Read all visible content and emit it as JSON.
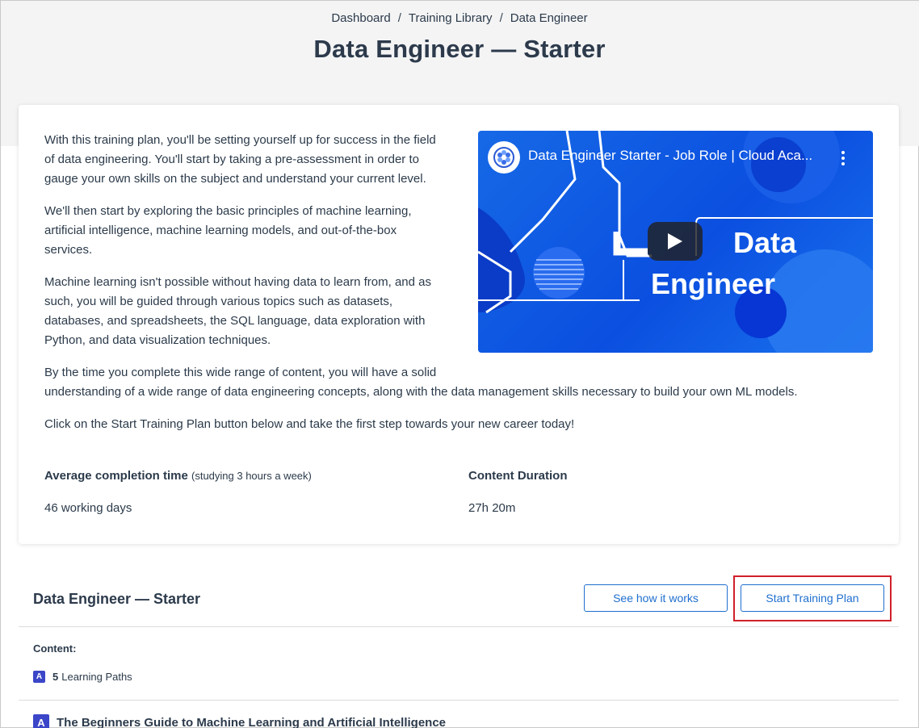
{
  "breadcrumb": {
    "items": [
      "Dashboard",
      "Training Library",
      "Data Engineer"
    ],
    "separator": "/"
  },
  "page_title": "Data Engineer — Starter",
  "description": {
    "paragraphs": [
      "With this training plan, you'll be setting yourself up for success in the field of data engineering. You'll start by taking a pre-assessment in order to gauge your own skills on the subject and understand your current level.",
      "We'll then start by exploring the basic principles of machine learning, artificial intelligence, machine learning models, and out-of-the-box services.",
      "Machine learning isn't possible without having data to learn from, and as such, you will be guided through various topics such as datasets, databases, and spreadsheets, the SQL language, data exploration with Python, and data visualization techniques.",
      "By the time you complete this wide range of content, you will have a solid understanding of a wide range of data engineering concepts, along with the data management skills necessary to build your own ML models.",
      "Click on the Start Training Plan button below and take the first step towards your new career today!"
    ],
    "lines": {
      "p1": [
        "With this training plan, you'll be setting yourself up for success in the field",
        "of data engineering. You'll start by taking a pre-assessment in order to",
        "gauge your own skills on the subject and understand your current level."
      ],
      "p2": [
        "We'll then start by exploring the basic principles of machine learning,",
        "artificial intelligence, machine learning models, and out-of-the-box",
        "services."
      ],
      "p3": [
        "Machine learning isn't possible without having data to learn from, and as",
        "such, you will be guided through various topics such as datasets,",
        "databases, and spreadsheets, the SQL language, data exploration with",
        "Python, and data visualization techniques."
      ],
      "p4": [
        "By the time you complete this wide range of content, you will have a solid",
        "understanding of a wide range of data engineering concepts, along with the data management skills necessary to build your own ML models."
      ],
      "p5": [
        "Click on the Start Training Plan button below and take the first step towards your new career today!"
      ]
    }
  },
  "video": {
    "title": "Data Engineer Starter - Job Role | Cloud Aca...",
    "overlay_line1": "Data",
    "overlay_line2": "Engineer",
    "logo_icon": "cloud-academy-logo-icon",
    "menu_icon": "more-vert-icon",
    "play_icon": "play-icon",
    "colors": {
      "background": "#0b4fe0",
      "accent": "#1a73ee"
    }
  },
  "stats": {
    "completion_label": "Average completion time",
    "completion_note": "(studying 3 hours a week)",
    "completion_value": "46 working days",
    "duration_label": "Content Duration",
    "duration_value": "27h 20m"
  },
  "plan": {
    "title": "Data Engineer — Starter",
    "see_how_label": "See how it works",
    "start_label": "Start Training Plan",
    "content_label": "Content:",
    "learning_paths_count": "5",
    "learning_paths_label": "Learning Paths",
    "first_path_title": "The Beginners Guide to Machine Learning and Artificial Intelligence"
  },
  "colors": {
    "primary": "#1f6fcf",
    "highlight": "#d0202a",
    "path_icon": "#3b46c8"
  }
}
